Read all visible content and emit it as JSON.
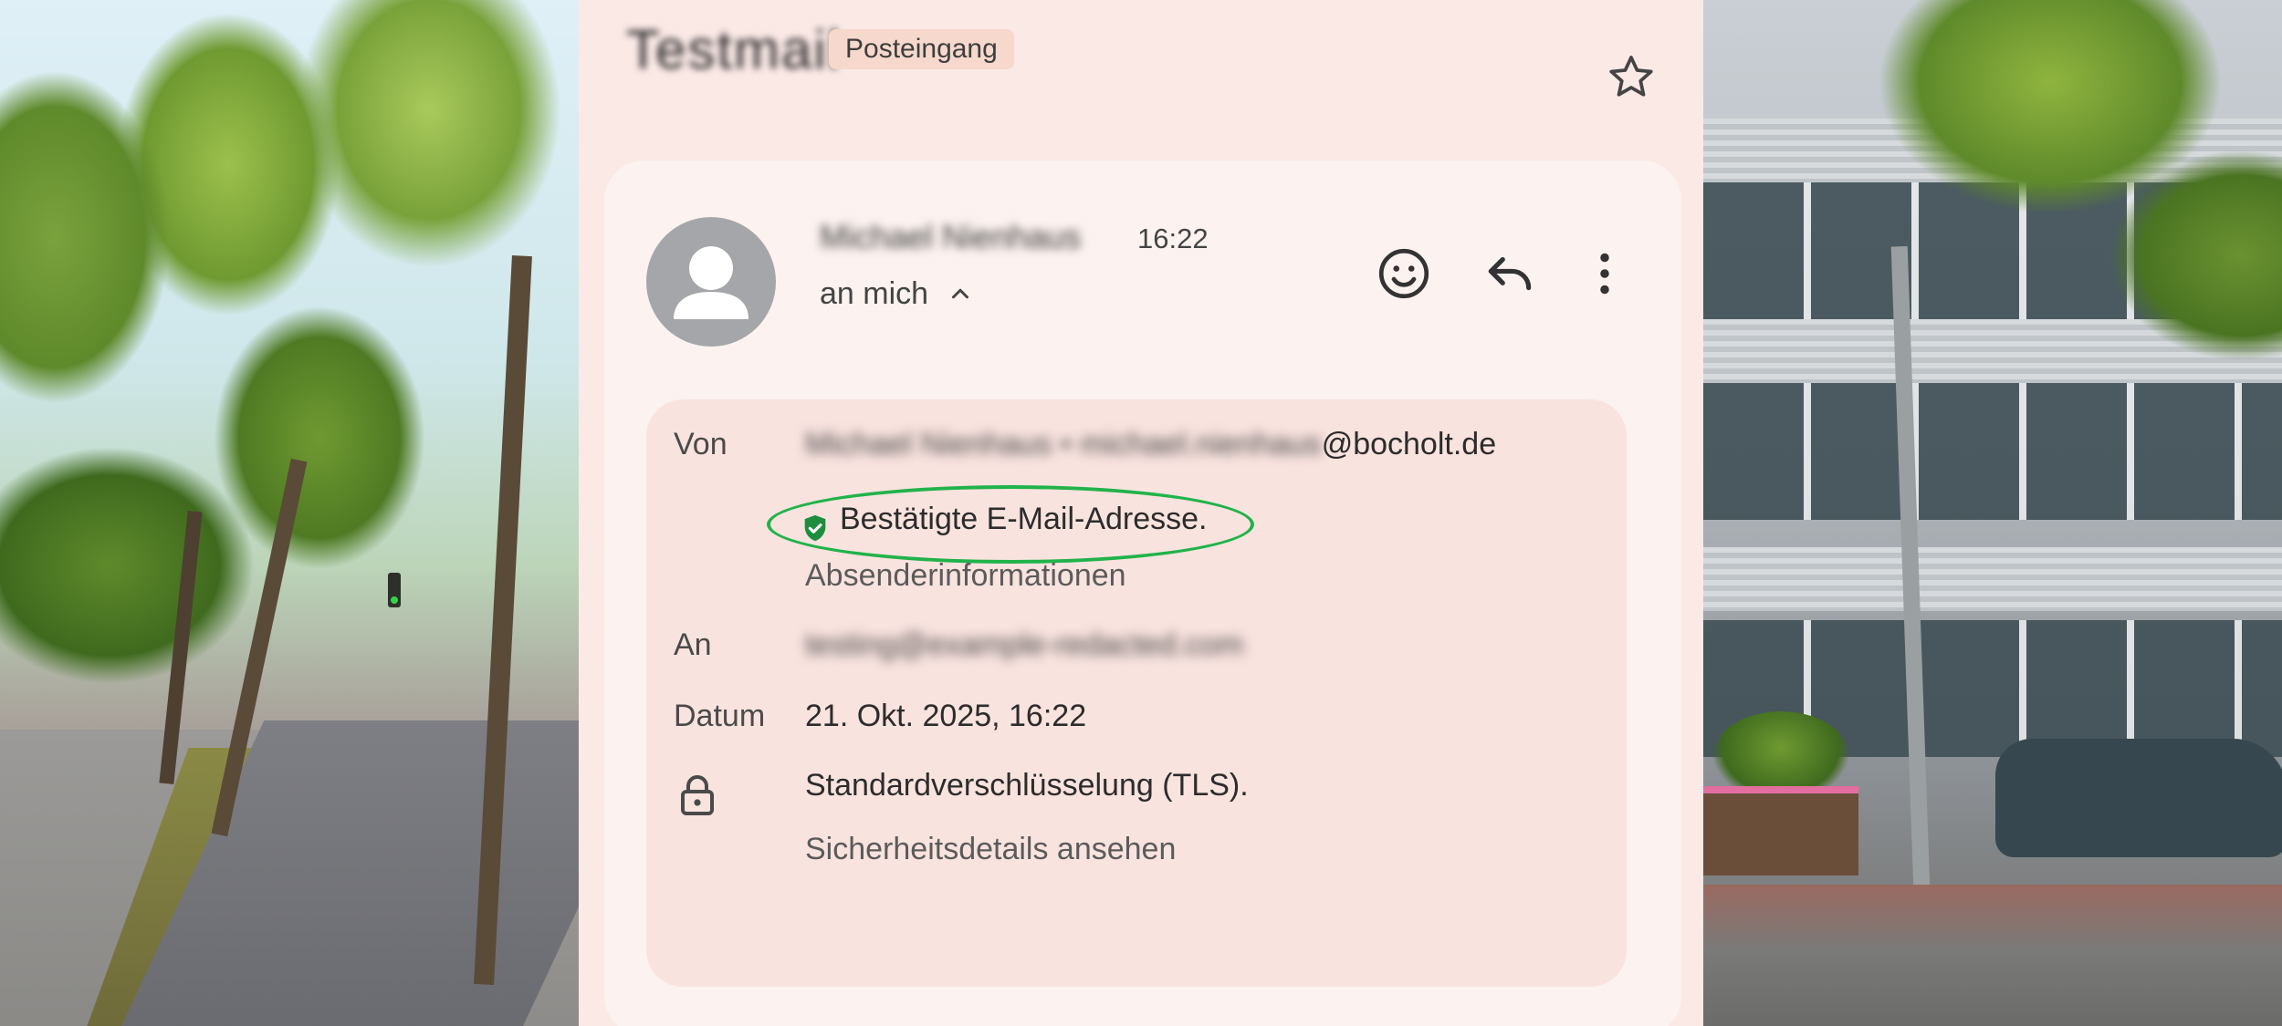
{
  "email": {
    "subject": "Testmail",
    "label": "Posteingang",
    "sender_name": "Michael Nienhaus",
    "time": "16:22",
    "recipient_summary": "an mich",
    "details": {
      "from_label": "Von",
      "from_name": "Michael Nienhaus",
      "from_separator": " • ",
      "from_local": "michael.nienhaus",
      "from_domain": "@bocholt.de",
      "verified_text": "Bestätigte E-Mail-Adresse.",
      "sender_info_link": "Absenderinformationen",
      "to_label": "An",
      "to_value": "testing@example-redacted.com",
      "date_label": "Datum",
      "date_value": "21. Okt. 2025, 16:22",
      "encryption_text": "Standardverschlüsselung (TLS).",
      "security_link": "Sicherheitsdetails ansehen"
    }
  },
  "icons": {
    "star": "star-icon",
    "emoji": "emoji-react-icon",
    "reply": "reply-icon",
    "more": "more-vert-icon",
    "chevron": "chevron-up-icon",
    "verified": "verified-shield-icon",
    "lock": "lock-icon"
  },
  "colors": {
    "panel_bg": "#fbe9e6",
    "card_bg": "#fcf2ef",
    "details_bg": "#f9e3df",
    "label_badge_bg": "#f7d8cc",
    "verified_highlight": "#21b34a"
  }
}
